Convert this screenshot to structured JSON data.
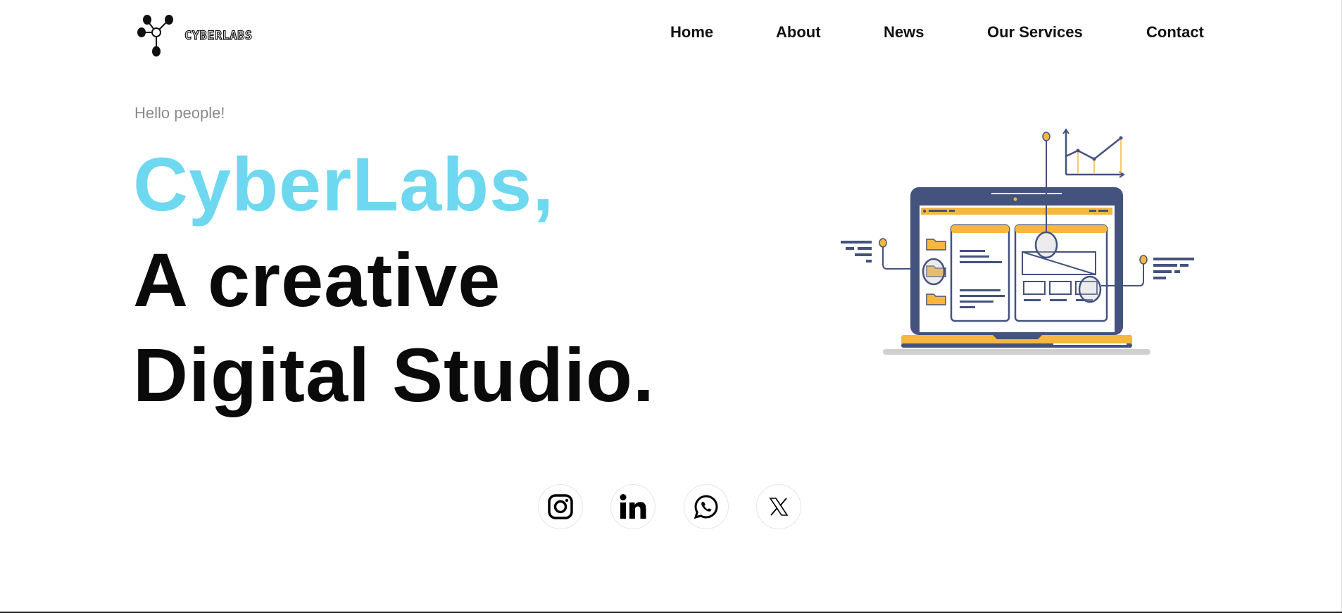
{
  "header": {
    "logo_text": "CYBERLABS",
    "nav": {
      "home": "Home",
      "about": "About",
      "news": "News",
      "services": "Our Services",
      "contact": "Contact"
    }
  },
  "hero": {
    "greeting": "Hello people!",
    "brand": "CyberLabs,",
    "line1": "A creative",
    "line2": "Digital Studio."
  },
  "socials": [
    {
      "icon": "instagram-icon"
    },
    {
      "icon": "linkedin-icon"
    },
    {
      "icon": "whatsapp-icon"
    },
    {
      "icon": "x-twitter-icon"
    }
  ],
  "colors": {
    "accent": "#6dd8ef",
    "text": "#0a0a0a",
    "muted": "#8a8a8a",
    "illustration_navy": "#44527e",
    "illustration_yellow": "#f6b73c"
  }
}
